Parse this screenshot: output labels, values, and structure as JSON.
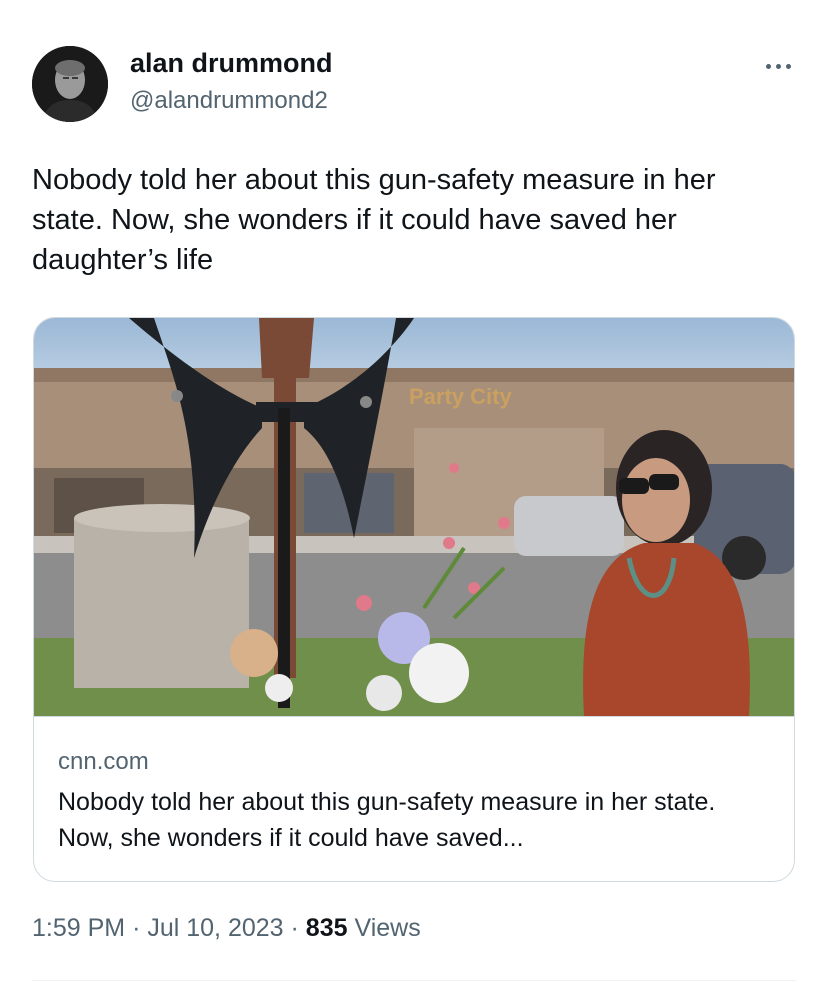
{
  "author": {
    "name": "alan drummond",
    "handle": "@alandrummond2"
  },
  "tweet": {
    "text": "Nobody told her about this gun-safety measure in her state. Now, she wonders if it could have saved her daughter’s life"
  },
  "link_card": {
    "image_sign_text": "Party City",
    "domain": "cnn.com",
    "title": "Nobody told her about this gun-safety measure in her state. Now, she wonders if it could have saved..."
  },
  "meta": {
    "time": "1:59 PM",
    "separator": "·",
    "date": "Jul 10, 2023",
    "views_count": "835",
    "views_label": "Views"
  },
  "icons": {
    "more": "more-horizontal-icon"
  },
  "colors": {
    "text_primary": "#0f1419",
    "text_secondary": "#536471",
    "border": "#cfd9de"
  }
}
